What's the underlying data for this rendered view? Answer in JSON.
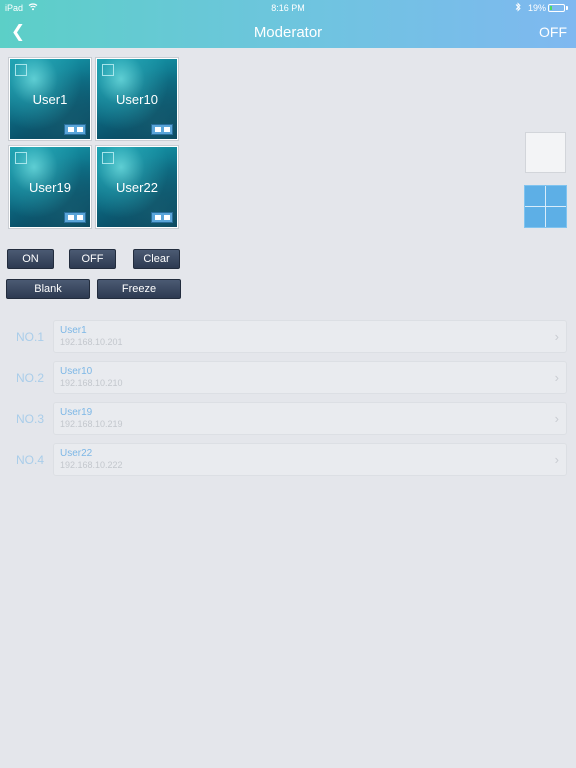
{
  "status_bar": {
    "carrier": "iPad",
    "wifi_icon": "wifi-icon",
    "time": "8:16 PM",
    "bluetooth_icon": "bluetooth-icon",
    "battery_text": "19%",
    "battery_level": 0.19,
    "battery_color": "#4cd964"
  },
  "header": {
    "back_icon": "chevron-left-icon",
    "title": "Moderator",
    "power_label": "OFF",
    "gradient_colors": [
      "#5ccfc7",
      "#7fb8f0"
    ]
  },
  "tiles": [
    {
      "label": "User1"
    },
    {
      "label": "User10"
    },
    {
      "label": "User19"
    },
    {
      "label": "User22"
    }
  ],
  "layout_options": [
    {
      "icon": "single-layout-icon",
      "selected": false
    },
    {
      "icon": "quad-layout-icon",
      "selected": true
    }
  ],
  "buttons": {
    "on": "ON",
    "off": "OFF",
    "clear": "Clear",
    "blank": "Blank",
    "freeze": "Freeze"
  },
  "users": [
    {
      "number": "NO.1",
      "name": "User1",
      "ip": "192.168.10.201"
    },
    {
      "number": "NO.2",
      "name": "User10",
      "ip": "192.168.10.210"
    },
    {
      "number": "NO.3",
      "name": "User19",
      "ip": "192.168.10.219"
    },
    {
      "number": "NO.4",
      "name": "User22",
      "ip": "192.168.10.222"
    }
  ],
  "colors": {
    "accent": "#5dafe6",
    "button_dark": "#2d3a51",
    "background": "#e4e6eb"
  }
}
